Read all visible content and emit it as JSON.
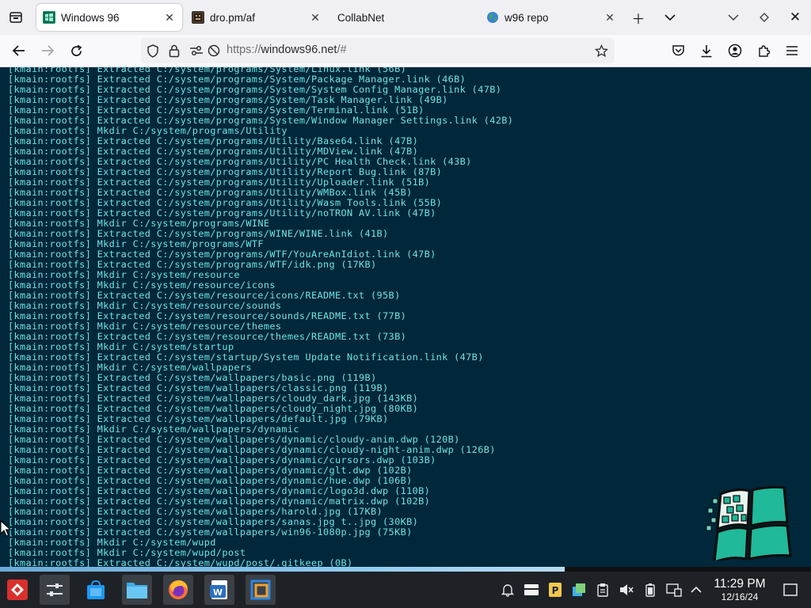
{
  "browser": {
    "tabs": [
      {
        "label": "Windows 96",
        "active": true,
        "favicon": "windows96-favicon"
      },
      {
        "label": "dro.pm/af",
        "active": false,
        "favicon": "dropm-favicon"
      },
      {
        "label": "CollabNet",
        "active": false,
        "favicon": "none"
      },
      {
        "label": "w96 repo",
        "active": false,
        "favicon": "globe-favicon"
      }
    ],
    "url": "https://windows96.net/#",
    "url_scheme": "https://",
    "url_host": "windows96.net",
    "url_rest": "/#"
  },
  "terminal": {
    "log": [
      "[kmain:rootfs] Extracted C:/system/programs/System/Linux.link (56B)",
      "[kmain:rootfs] Extracted C:/system/programs/System/Package Manager.link (46B)",
      "[kmain:rootfs] Extracted C:/system/programs/System/System Config Manager.link (47B)",
      "[kmain:rootfs] Extracted C:/system/programs/System/Task Manager.link (49B)",
      "[kmain:rootfs] Extracted C:/system/programs/System/Terminal.link (51B)",
      "[kmain:rootfs] Extracted C:/system/programs/System/Window Manager Settings.link (42B)",
      "[kmain:rootfs] Mkdir C:/system/programs/Utility",
      "[kmain:rootfs] Extracted C:/system/programs/Utility/Base64.link (47B)",
      "[kmain:rootfs] Extracted C:/system/programs/Utility/MDView.link (47B)",
      "[kmain:rootfs] Extracted C:/system/programs/Utility/PC Health Check.link (43B)",
      "[kmain:rootfs] Extracted C:/system/programs/Utility/Report Bug.link (87B)",
      "[kmain:rootfs] Extracted C:/system/programs/Utility/Uploader.link (51B)",
      "[kmain:rootfs] Extracted C:/system/programs/Utility/WMBox.link (45B)",
      "[kmain:rootfs] Extracted C:/system/programs/Utility/Wasm Tools.link (55B)",
      "[kmain:rootfs] Extracted C:/system/programs/Utility/noTRON AV.link (47B)",
      "[kmain:rootfs] Mkdir C:/system/programs/WINE",
      "[kmain:rootfs] Extracted C:/system/programs/WINE/WINE.link (41B)",
      "[kmain:rootfs] Mkdir C:/system/programs/WTF",
      "[kmain:rootfs] Extracted C:/system/programs/WTF/YouAreAnIdiot.link (47B)",
      "[kmain:rootfs] Extracted C:/system/programs/WTF/idk.png (17KB)",
      "[kmain:rootfs] Mkdir C:/system/resource",
      "[kmain:rootfs] Mkdir C:/system/resource/icons",
      "[kmain:rootfs] Extracted C:/system/resource/icons/README.txt (95B)",
      "[kmain:rootfs] Mkdir C:/system/resource/sounds",
      "[kmain:rootfs] Extracted C:/system/resource/sounds/README.txt (77B)",
      "[kmain:rootfs] Mkdir C:/system/resource/themes",
      "[kmain:rootfs] Extracted C:/system/resource/themes/README.txt (73B)",
      "[kmain:rootfs] Mkdir C:/system/startup",
      "[kmain:rootfs] Extracted C:/system/startup/System Update Notification.link (47B)",
      "[kmain:rootfs] Mkdir C:/system/wallpapers",
      "[kmain:rootfs] Extracted C:/system/wallpapers/basic.png (119B)",
      "[kmain:rootfs] Extracted C:/system/wallpapers/classic.png (119B)",
      "[kmain:rootfs] Extracted C:/system/wallpapers/cloudy_dark.jpg (143KB)",
      "[kmain:rootfs] Extracted C:/system/wallpapers/cloudy_night.jpg (80KB)",
      "[kmain:rootfs] Extracted C:/system/wallpapers/default.jpg (79KB)",
      "[kmain:rootfs] Mkdir C:/system/wallpapers/dynamic",
      "[kmain:rootfs] Extracted C:/system/wallpapers/dynamic/cloudy-anim.dwp (120B)",
      "[kmain:rootfs] Extracted C:/system/wallpapers/dynamic/cloudy-night-anim.dwp (126B)",
      "[kmain:rootfs] Extracted C:/system/wallpapers/dynamic/cursors.dwp (103B)",
      "[kmain:rootfs] Extracted C:/system/wallpapers/dynamic/glt.dwp (102B)",
      "[kmain:rootfs] Extracted C:/system/wallpapers/dynamic/hue.dwp (106B)",
      "[kmain:rootfs] Extracted C:/system/wallpapers/dynamic/logo3d.dwp (110B)",
      "[kmain:rootfs] Extracted C:/system/wallpapers/dynamic/matrix.dwp (102B)",
      "[kmain:rootfs] Extracted C:/system/wallpapers/harold.jpg (17KB)",
      "[kmain:rootfs] Extracted C:/system/wallpapers/sanas.jpg t..jpg (30KB)",
      "[kmain:rootfs] Extracted C:/system/wallpapers/win96-1080p.jpg (75KB)",
      "[kmain:rootfs] Mkdir C:/system/wupd",
      "[kmain:rootfs] Mkdir C:/system/wupd/post",
      "[kmain:rootfs] Extracted C:/system/wupd/post/.gitkeep (0B)"
    ],
    "progress_fraction": 0.696
  },
  "taskbar": {
    "apps": [
      "app-launcher-icon",
      "system-settings-icon",
      "discover-store-icon",
      "file-manager-icon",
      "firefox-icon",
      "writer-icon",
      "virtualbox-icon"
    ],
    "clock_time": "11:29 PM",
    "clock_date": "12/16/24"
  }
}
